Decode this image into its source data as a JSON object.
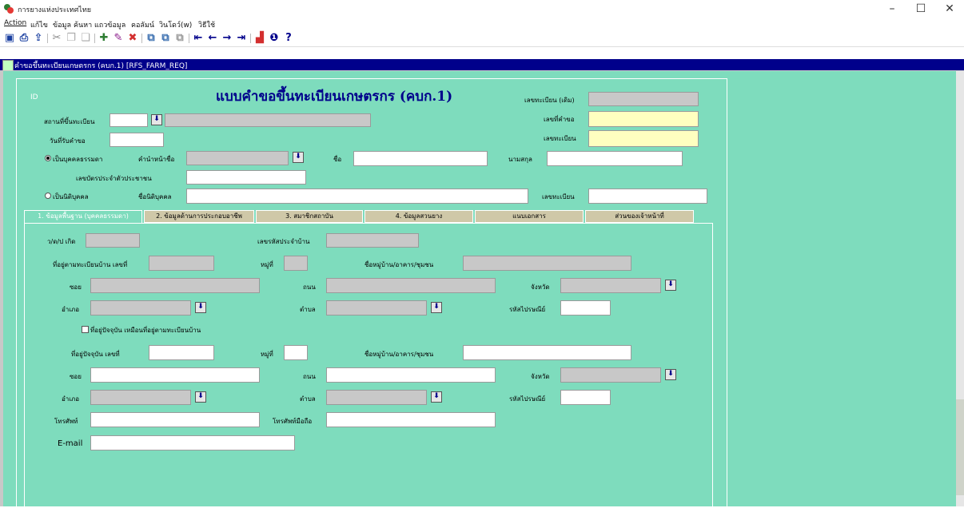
{
  "window": {
    "title": "การยางแห่งประเทศไทย",
    "minimize": "–",
    "maximize": "☐",
    "close": "✕"
  },
  "menu": [
    "Action",
    "แก้ไข",
    "ข้อมูล",
    "ค้นหา",
    "แถวข้อมูล",
    "คอลัมน์",
    "วินโดว์(w)",
    "วิธีใช้"
  ],
  "toolbar_icons": [
    "save-icon",
    "print-icon",
    "exit-icon",
    "cut-icon",
    "copy-icon",
    "paste-icon",
    "insert-record-icon",
    "edit-record-icon",
    "delete-record-icon",
    "duplicate-icon",
    "duplicate-record-icon",
    "clear-icon",
    "first-record-icon",
    "previous-record-icon",
    "next-record-icon",
    "last-record-icon",
    "chart-icon",
    "info-icon",
    "help-icon"
  ],
  "form_title_bar": "คำขอขึ้นทะเบียนเกษตรกร (คบก.1) [RFS_FARM_REQ]",
  "header": {
    "id_label": "ID",
    "title": "แบบคำขอขึ้นทะเบียนเกษตรกร (คบก.1)",
    "old_reg_label": "เลขทะเบียน (เดิม)",
    "reg_place_label": "สถานที่ขึ้นทะเบียน",
    "request_no_label": "เลขที่คำขอ",
    "receive_date_label": "วันที่รับคำขอ",
    "reg_no_label": "เลขทะเบียน"
  },
  "person": {
    "natural_label": "เป็นบุคคลธรรมดา",
    "prefix_label": "คำนำหน้าชื่อ",
    "name_label": "ชื่อ",
    "surname_label": "นามสกุล",
    "id_card_label": "เลขบัตรประจำตัวประชาชน",
    "juristic_label": "เป็นนิติบุคคล",
    "juristic_name_label": "ชื่อนิติบุคคล",
    "juristic_reg_label": "เลขทะเบียน"
  },
  "tabs": [
    "1. ข้อมูลพื้นฐาน (บุคคลธรรมดา)",
    "2. ข้อมูลด้านการประกอบอาชีพ",
    "3. สมาชิกสถาบัน",
    "4. ข้อมูลสวนยาง",
    "แนบเอกสาร",
    "ส่วนของเจ้าหน้าที่"
  ],
  "basic": {
    "birthdate_label": "ว/ด/ป เกิด",
    "house_code_label": "เลขรหัสประจำบ้าน",
    "reg_addr_label": "ที่อยู่ตามทะเบียนบ้าน เลขที่",
    "moo_label": "หมู่ที่",
    "village_label": "ชื่อหมู่บ้าน/อาคาร/ชุมชน",
    "soi_label": "ซอย",
    "road_label": "ถนน",
    "province_label": "จังหวัด",
    "amphoe_label": "อำเภอ",
    "tambon_label": "ตำบล",
    "postcode_label": "รหัสไปรษณีย์",
    "same_addr_label": "ที่อยู่ปัจจุบัน เหมือนที่อยู่ตามทะเบียนบ้าน",
    "cur_addr_label": "ที่อยู่ปัจจุบัน เลขที่",
    "phone_label": "โทรศัพท์",
    "mobile_label": "โทรศัพท์มือถือ",
    "email_label": "E-mail"
  },
  "colors": {
    "form_bg": "#7edcbd",
    "title_text": "#00008b",
    "title_bar": "#00008b",
    "tab_inactive": "#cfc8a8"
  }
}
